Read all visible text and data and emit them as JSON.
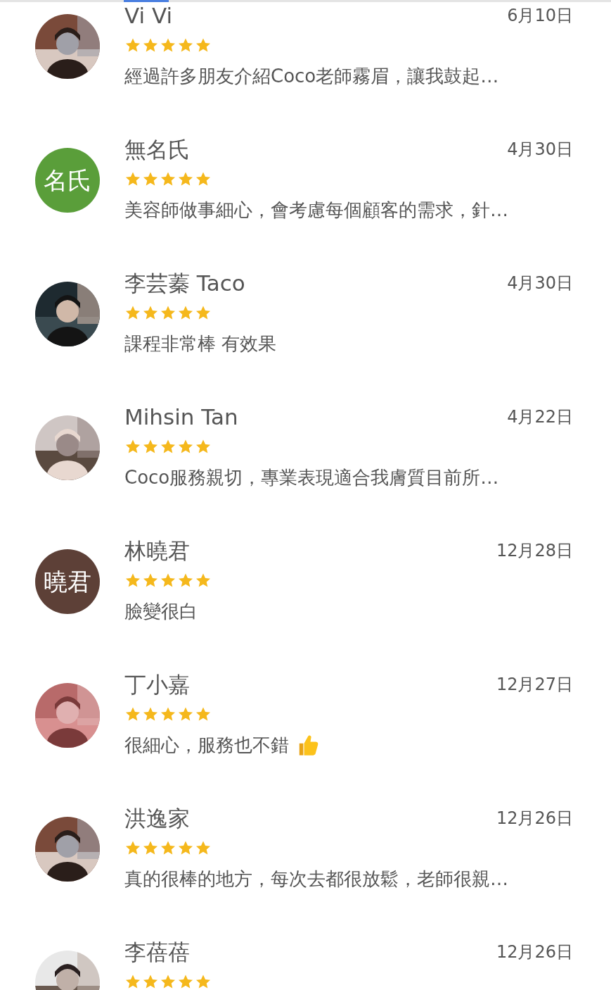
{
  "reviews": [
    {
      "name": "Vi Vi",
      "date": "6月10日",
      "stars": 5,
      "text": "經過許多朋友介紹Coco老師霧眉，讓我鼓起…"
    },
    {
      "name": "無名氏",
      "date": "4月30日",
      "stars": 5,
      "text": "美容師做事細心，會考慮每個顧客的需求，針…",
      "avatar": {
        "kind": "initials",
        "text": "名氏",
        "color": "#5a9e3a"
      }
    },
    {
      "name": "李芸蓁 Taco",
      "date": "4月30日",
      "stars": 5,
      "text": "課程非常棒 有效果"
    },
    {
      "name": "Mihsin Tan",
      "date": "4月22日",
      "stars": 5,
      "text": "Coco服務親切，專業表現適合我膚質目前所…"
    },
    {
      "name": "林曉君",
      "date": "12月28日",
      "stars": 5,
      "text": "臉變很白",
      "avatar": {
        "kind": "initials",
        "text": "曉君",
        "color": "#5d4037"
      }
    },
    {
      "name": "丁小嘉",
      "date": "12月27日",
      "stars": 5,
      "text": "很細心，服務也不錯",
      "thumbs_up": true
    },
    {
      "name": "洪逸家",
      "date": "12月26日",
      "stars": 5,
      "text": "真的很棒的地方，每次去都很放鬆，老師很親…"
    },
    {
      "name": "李蓓蓓",
      "date": "12月26日",
      "stars": 5
    }
  ]
}
